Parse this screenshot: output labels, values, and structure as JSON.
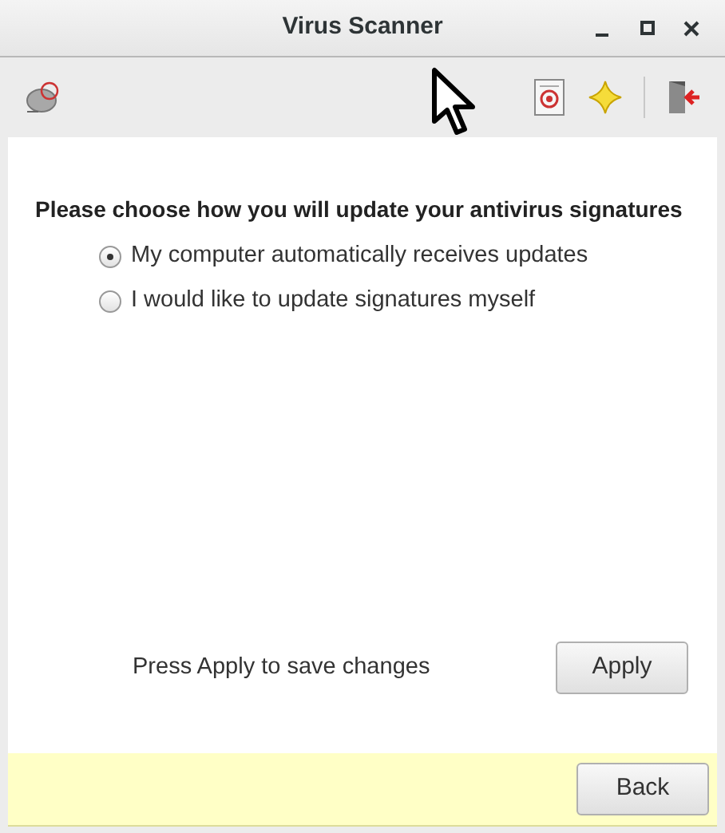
{
  "window": {
    "title": "Virus Scanner"
  },
  "heading": "Please choose how you will update your antivirus signatures",
  "options": [
    {
      "label": "My computer automatically receives updates",
      "selected": true
    },
    {
      "label": "I would like to update signatures myself",
      "selected": false
    }
  ],
  "hint": "Press Apply to save changes",
  "apply_button": "Apply",
  "back_button": "Back"
}
